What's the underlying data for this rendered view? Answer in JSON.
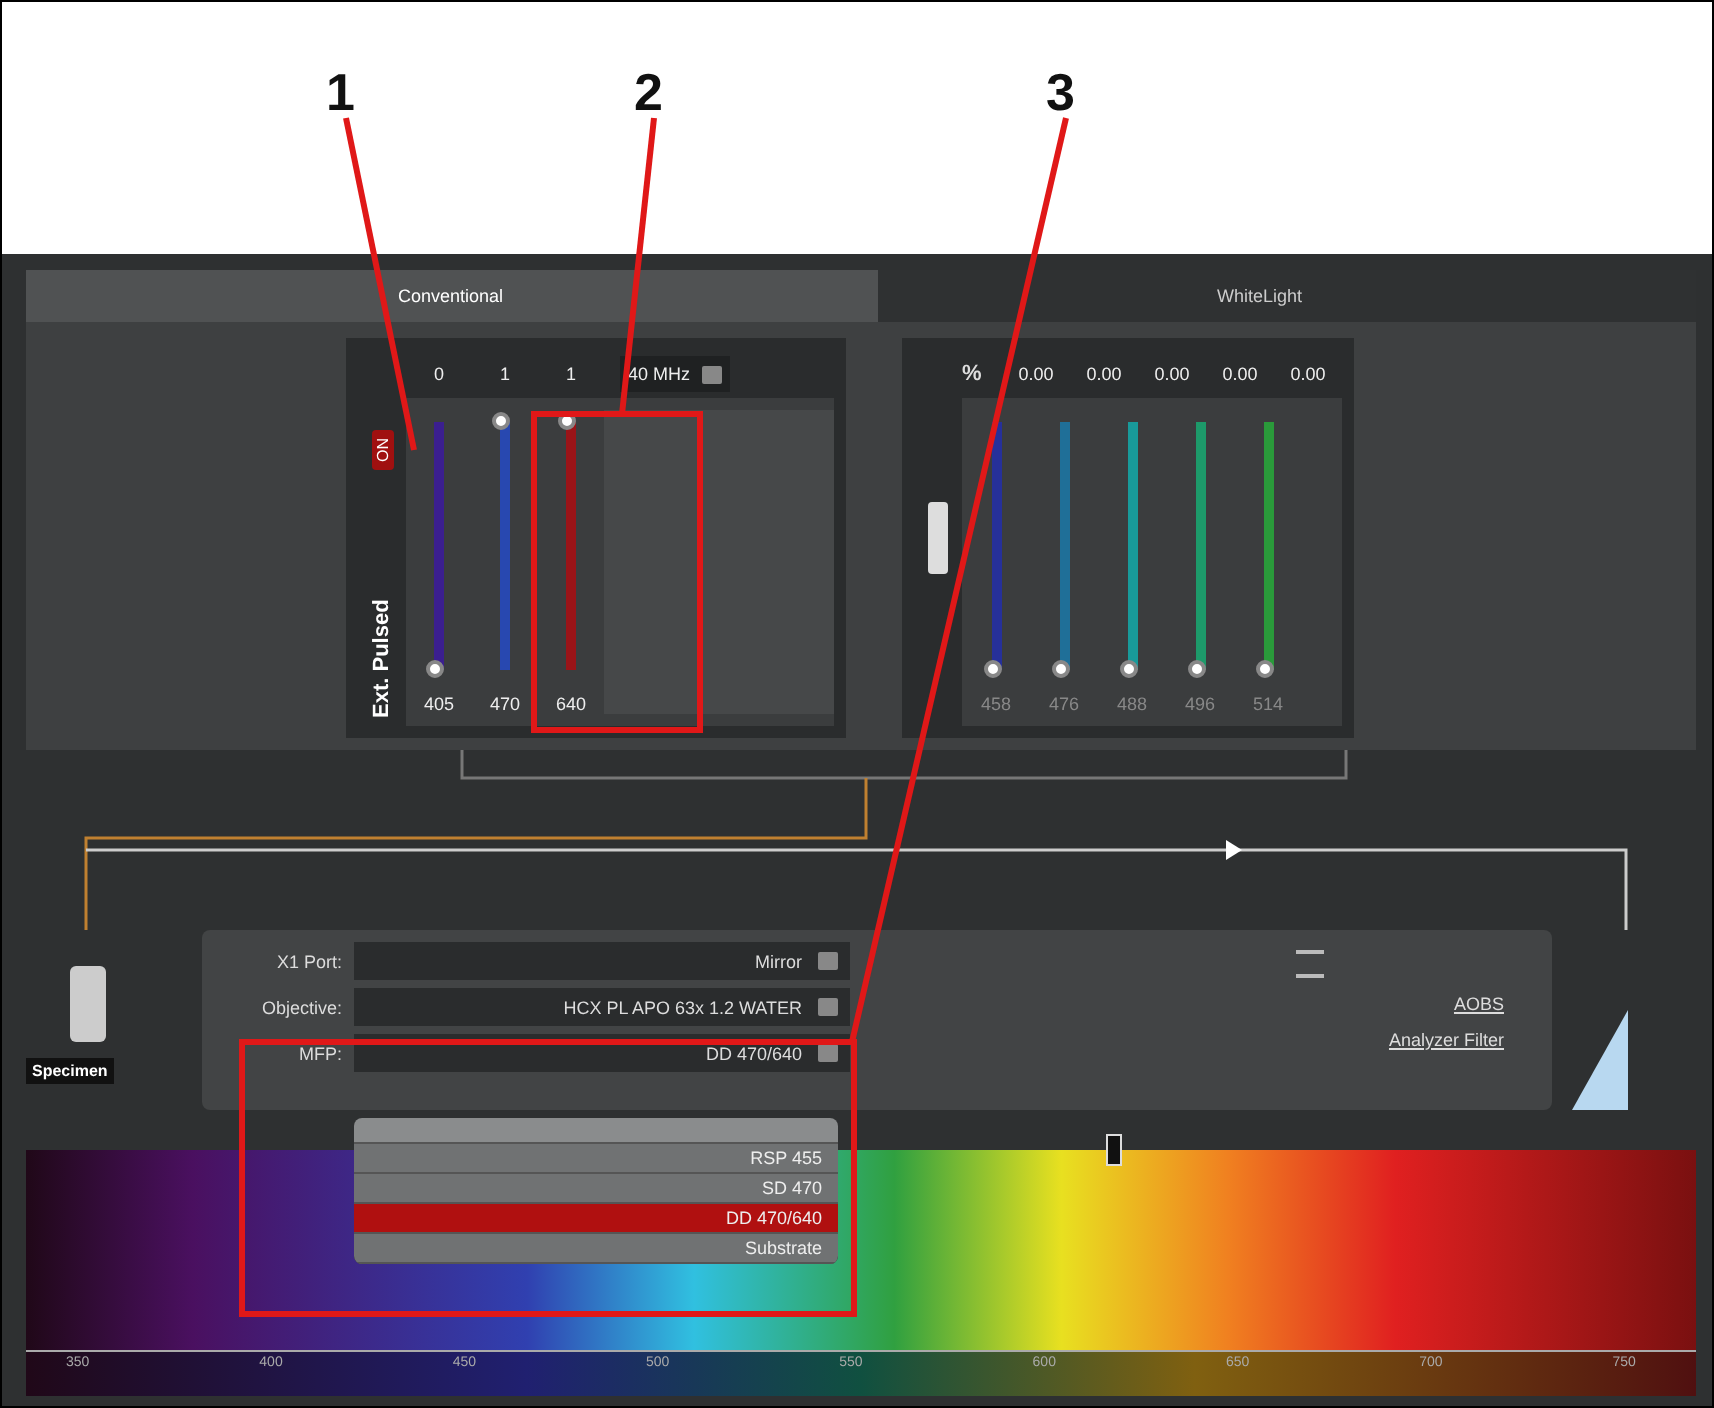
{
  "callouts": [
    "1",
    "2",
    "3"
  ],
  "tabs": [
    {
      "label": "Conventional",
      "selected": true
    },
    {
      "label": "WhiteLight",
      "selected": false
    }
  ],
  "pulsed_laser": {
    "label": "Ext. Pulsed",
    "toggle": {
      "label": "ON",
      "on": true
    },
    "frequency": "40 MHz",
    "lines": [
      {
        "value": "0",
        "wavelength": "405",
        "level": 0,
        "color": "#3b1f8f"
      },
      {
        "value": "1",
        "wavelength": "470",
        "level": 1,
        "color": "#2848b0"
      },
      {
        "value": "1",
        "wavelength": "640",
        "level": 1,
        "color": "#9a1418"
      }
    ]
  },
  "visible_laser": {
    "unit": "%",
    "lines": [
      {
        "value": "0.00",
        "wavelength": "458",
        "level": 0,
        "color": "#26309a"
      },
      {
        "value": "0.00",
        "wavelength": "476",
        "level": 0,
        "color": "#1f6f98"
      },
      {
        "value": "0.00",
        "wavelength": "488",
        "level": 0,
        "color": "#189a9a"
      },
      {
        "value": "0.00",
        "wavelength": "496",
        "level": 0,
        "color": "#1d9a6a"
      },
      {
        "value": "0.00",
        "wavelength": "514",
        "level": 0,
        "color": "#2a9a3a"
      }
    ]
  },
  "light_path": {
    "specimen_label": "Specimen",
    "settings": [
      {
        "label": "X1 Port:",
        "value": "Mirror"
      },
      {
        "label": "Objective:",
        "value": "HCX PL APO 63x 1.2 WATER"
      },
      {
        "label": "MFP:",
        "value": "DD 470/640"
      }
    ],
    "links": [
      "AOBS",
      "Analyzer Filter"
    ]
  },
  "mfp_menu": {
    "options": [
      {
        "label": "RSP 455",
        "selected": false
      },
      {
        "label": "SD 470",
        "selected": false
      },
      {
        "label": "DD 470/640",
        "selected": true
      },
      {
        "label": "Substrate",
        "selected": false
      }
    ]
  },
  "spectrum": {
    "scale": [
      "350",
      "400",
      "450",
      "500",
      "550",
      "600",
      "650",
      "700",
      "750"
    ]
  }
}
